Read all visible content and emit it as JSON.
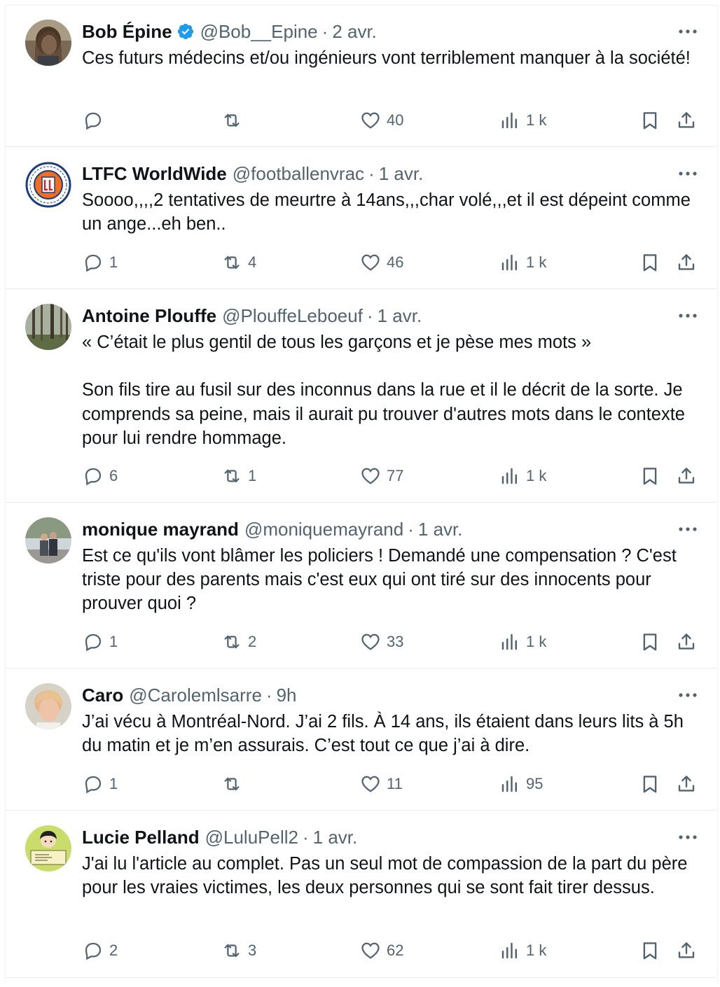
{
  "colors": {
    "text": "#0f1419",
    "secondary": "#536471",
    "verified": "#1d9bf0",
    "divider": "#e8ecee"
  },
  "tweets": [
    {
      "name": "Bob Épine",
      "verified": true,
      "handle": "@Bob__Epine",
      "dot": "·",
      "time": "2 avr.",
      "avatar_icon": "avatar-man-long-hair",
      "text": "Ces futurs médecins et/ou ingénieurs vont terriblement manquer à la société!",
      "replies": "",
      "retweets": "",
      "likes": "40",
      "views": "1 k"
    },
    {
      "name": "LTFC WorldWide",
      "verified": false,
      "handle": "@footballenvrac",
      "dot": "·",
      "time": "1 avr.",
      "avatar_icon": "avatar-luton-town-crest",
      "text": "Soooo,,,,2 tentatives de meurtre à 14ans,,,char volé,,,et il est dépeint comme un ange...eh ben..",
      "replies": "1",
      "retweets": "4",
      "likes": "46",
      "views": "1 k"
    },
    {
      "name": "Antoine Plouffe",
      "verified": false,
      "handle": "@PlouffeLeboeuf",
      "dot": "·",
      "time": "1 avr.",
      "avatar_icon": "avatar-forest",
      "text": "« C’était le plus gentil de tous les garçons et je pèse mes mots »\n\nSon fils tire au fusil sur des inconnus dans la rue et il le décrit de la sorte. Je comprends sa peine, mais il aurait pu trouver d'autres mots dans le contexte pour lui rendre hommage.",
      "replies": "6",
      "retweets": "1",
      "likes": "77",
      "views": "1 k"
    },
    {
      "name": "monique mayrand",
      "verified": false,
      "handle": "@moniquemayrand",
      "dot": "·",
      "time": "1 avr.",
      "avatar_icon": "avatar-couple-outdoors",
      "text": "Est ce qu'ils vont blâmer les policiers ! Demandé une compensation ? C'est triste pour des parents mais c'est eux qui ont tiré sur des innocents pour prouver quoi ?",
      "replies": "1",
      "retweets": "2",
      "likes": "33",
      "views": "1 k"
    },
    {
      "name": "Caro",
      "verified": false,
      "handle": "@Carolemlsarre",
      "dot": "·",
      "time": "9h",
      "avatar_icon": "avatar-woman-blonde",
      "text": "J’ai vécu à Montréal-Nord. J’ai 2 fils. À 14 ans, ils étaient dans leurs lits à 5h du matin et je m’en assurais. C’est tout ce que j’ai à dire.",
      "replies": "1",
      "retweets": "",
      "likes": "11",
      "views": "95"
    },
    {
      "name": "Lucie Pelland",
      "verified": false,
      "handle": "@LuluPell2",
      "dot": "·",
      "time": "1 avr.",
      "avatar_icon": "avatar-lucy-cartoon",
      "text": "J'ai lu l'article au complet. Pas un seul mot de compassion de la part du père pour les vraies victimes, les deux personnes qui se sont fait tirer dessus.",
      "replies": "2",
      "retweets": "3",
      "likes": "62",
      "views": "1 k"
    }
  ]
}
